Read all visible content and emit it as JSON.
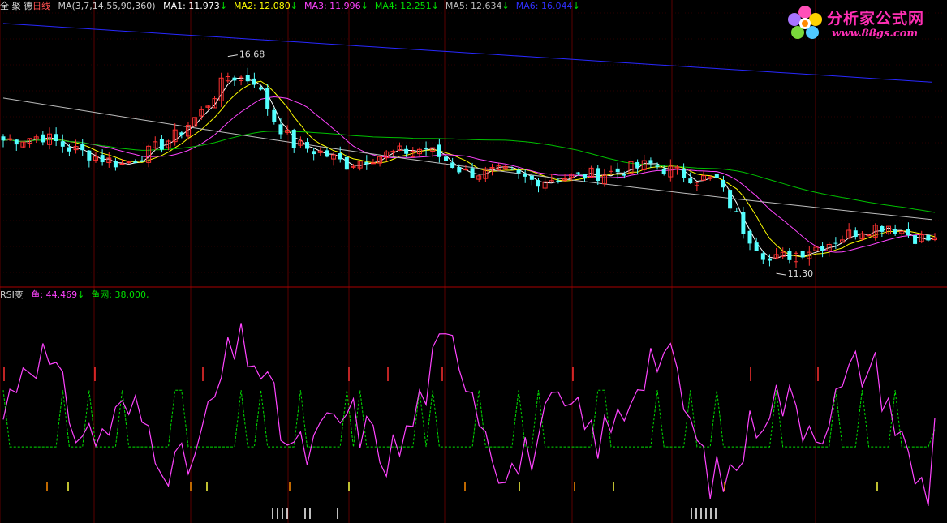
{
  "top_header": {
    "stock_name": "全 聚 德",
    "period": "日线",
    "ma_title": "MA(3,7,14,55,90,360)",
    "ma_items": [
      {
        "label": "MA1: 11.973",
        "arrow": "↓",
        "color": "#ffffff"
      },
      {
        "label": "MA2: 12.080",
        "arrow": "↓",
        "color": "#ffff00"
      },
      {
        "label": "MA3: 11.996",
        "arrow": "↓",
        "color": "#ff44ff"
      },
      {
        "label": "MA4: 12.251",
        "arrow": "↓",
        "color": "#00e000"
      },
      {
        "label": "MA5: 12.634",
        "arrow": "↓",
        "color": "#bbbbbb"
      },
      {
        "label": "MA6: 16.044",
        "arrow": "↓",
        "color": "#3030ff"
      }
    ]
  },
  "rsi_header": {
    "title": "RSI变",
    "items": [
      {
        "label": "鱼: 44.469",
        "arrow": "↓",
        "color": "#ff44ff"
      },
      {
        "label": "鱼网: 38.000,",
        "arrow": "",
        "color": "#00e000"
      }
    ]
  },
  "logo": {
    "line1": "分析家公式网",
    "line2": "www.88gs.com"
  },
  "colors": {
    "up": "#ff3232",
    "down": "#54ffff",
    "ma1": "#ffffff",
    "ma2": "#ffff00",
    "ma3": "#ff44ff",
    "ma4": "#00c000",
    "ma5": "#bbbbbb",
    "ma6": "#2828ff",
    "rsi": "#ff44ff",
    "net": "#00e000",
    "grid": "#5a0000"
  },
  "chart_data": [
    {
      "type": "candlestick",
      "ylim": [
        11.0,
        17.8
      ],
      "annotations": [
        {
          "text": "16.68",
          "value": 16.68,
          "index": 34,
          "kind": "high"
        },
        {
          "text": "11.30",
          "value": 11.3,
          "index": 117,
          "kind": "low"
        }
      ],
      "ma_final": {
        "MA1": 11.973,
        "MA2": 12.08,
        "MA3": 11.996,
        "MA4": 12.251,
        "MA5": 12.634,
        "MA6": 16.044
      },
      "ma6_range": [
        17.5,
        16.044
      ],
      "ma5_range": [
        15.65,
        12.634
      ]
    },
    {
      "type": "line",
      "series_names": [
        "鱼",
        "鱼网"
      ],
      "ylim": [
        -15,
        110
      ],
      "rsi_last": 44.469,
      "net_last": 38.0
    }
  ]
}
